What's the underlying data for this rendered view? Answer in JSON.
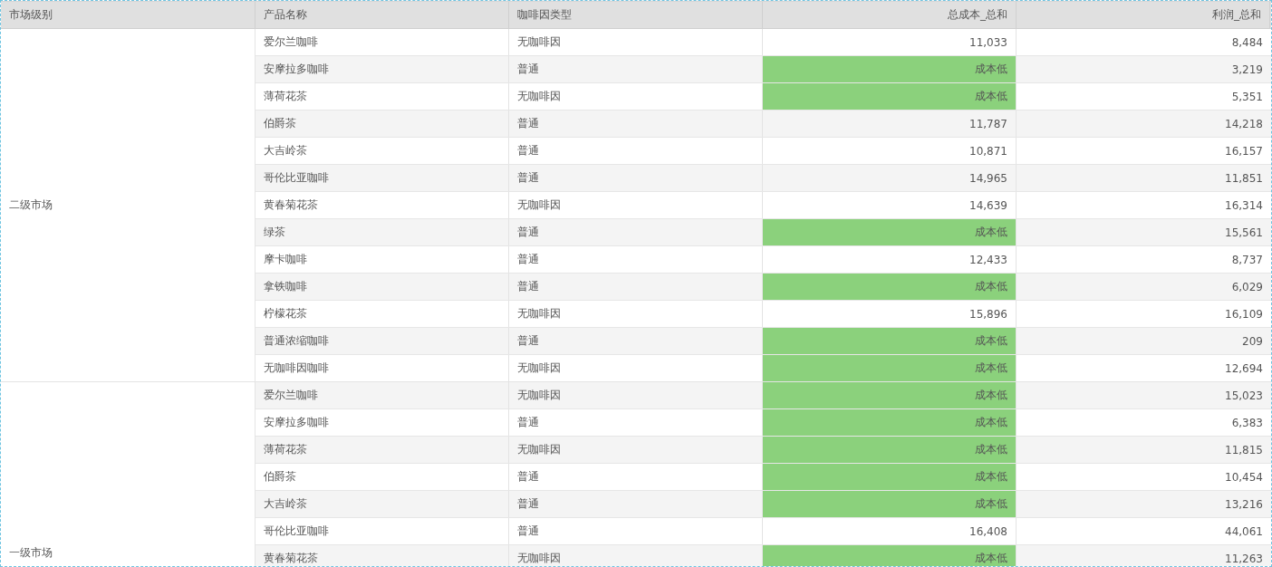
{
  "table": {
    "columns": [
      "市场级别",
      "产品名称",
      "咖啡因类型",
      "总成本_总和",
      "利润_总和"
    ],
    "groups": [
      {
        "market": "二级市场",
        "rows": [
          {
            "product": "爱尔兰咖啡",
            "caffeine": "无咖啡因",
            "cost": "11,033",
            "cost_low": false,
            "profit": "8,484"
          },
          {
            "product": "安摩拉多咖啡",
            "caffeine": "普通",
            "cost": "成本低",
            "cost_low": true,
            "profit": "3,219"
          },
          {
            "product": "薄荷花茶",
            "caffeine": "无咖啡因",
            "cost": "成本低",
            "cost_low": true,
            "profit": "5,351"
          },
          {
            "product": "伯爵茶",
            "caffeine": "普通",
            "cost": "11,787",
            "cost_low": false,
            "profit": "14,218"
          },
          {
            "product": "大吉岭茶",
            "caffeine": "普通",
            "cost": "10,871",
            "cost_low": false,
            "profit": "16,157"
          },
          {
            "product": "哥伦比亚咖啡",
            "caffeine": "普通",
            "cost": "14,965",
            "cost_low": false,
            "profit": "11,851"
          },
          {
            "product": "黄春菊花茶",
            "caffeine": "无咖啡因",
            "cost": "14,639",
            "cost_low": false,
            "profit": "16,314"
          },
          {
            "product": "绿茶",
            "caffeine": "普通",
            "cost": "成本低",
            "cost_low": true,
            "profit": "15,561"
          },
          {
            "product": "摩卡咖啡",
            "caffeine": "普通",
            "cost": "12,433",
            "cost_low": false,
            "profit": "8,737"
          },
          {
            "product": "拿铁咖啡",
            "caffeine": "普通",
            "cost": "成本低",
            "cost_low": true,
            "profit": "6,029"
          },
          {
            "product": "柠檬花茶",
            "caffeine": "无咖啡因",
            "cost": "15,896",
            "cost_low": false,
            "profit": "16,109"
          },
          {
            "product": "普通浓缩咖啡",
            "caffeine": "普通",
            "cost": "成本低",
            "cost_low": true,
            "profit": "209"
          },
          {
            "product": "无咖啡因咖啡",
            "caffeine": "无咖啡因",
            "cost": "成本低",
            "cost_low": true,
            "profit": "12,694"
          }
        ]
      },
      {
        "market": "一级市场",
        "rows": [
          {
            "product": "爱尔兰咖啡",
            "caffeine": "无咖啡因",
            "cost": "成本低",
            "cost_low": true,
            "profit": "15,023"
          },
          {
            "product": "安摩拉多咖啡",
            "caffeine": "普通",
            "cost": "成本低",
            "cost_low": true,
            "profit": "6,383"
          },
          {
            "product": "薄荷花茶",
            "caffeine": "无咖啡因",
            "cost": "成本低",
            "cost_low": true,
            "profit": "11,815"
          },
          {
            "product": "伯爵茶",
            "caffeine": "普通",
            "cost": "成本低",
            "cost_low": true,
            "profit": "10,454"
          },
          {
            "product": "大吉岭茶",
            "caffeine": "普通",
            "cost": "成本低",
            "cost_low": true,
            "profit": "13,216"
          },
          {
            "product": "哥伦比亚咖啡",
            "caffeine": "普通",
            "cost": "16,408",
            "cost_low": false,
            "profit": "44,061"
          },
          {
            "product": "黄春菊花茶",
            "caffeine": "无咖啡因",
            "cost": "成本低",
            "cost_low": true,
            "profit": "11,263"
          }
        ]
      }
    ]
  }
}
